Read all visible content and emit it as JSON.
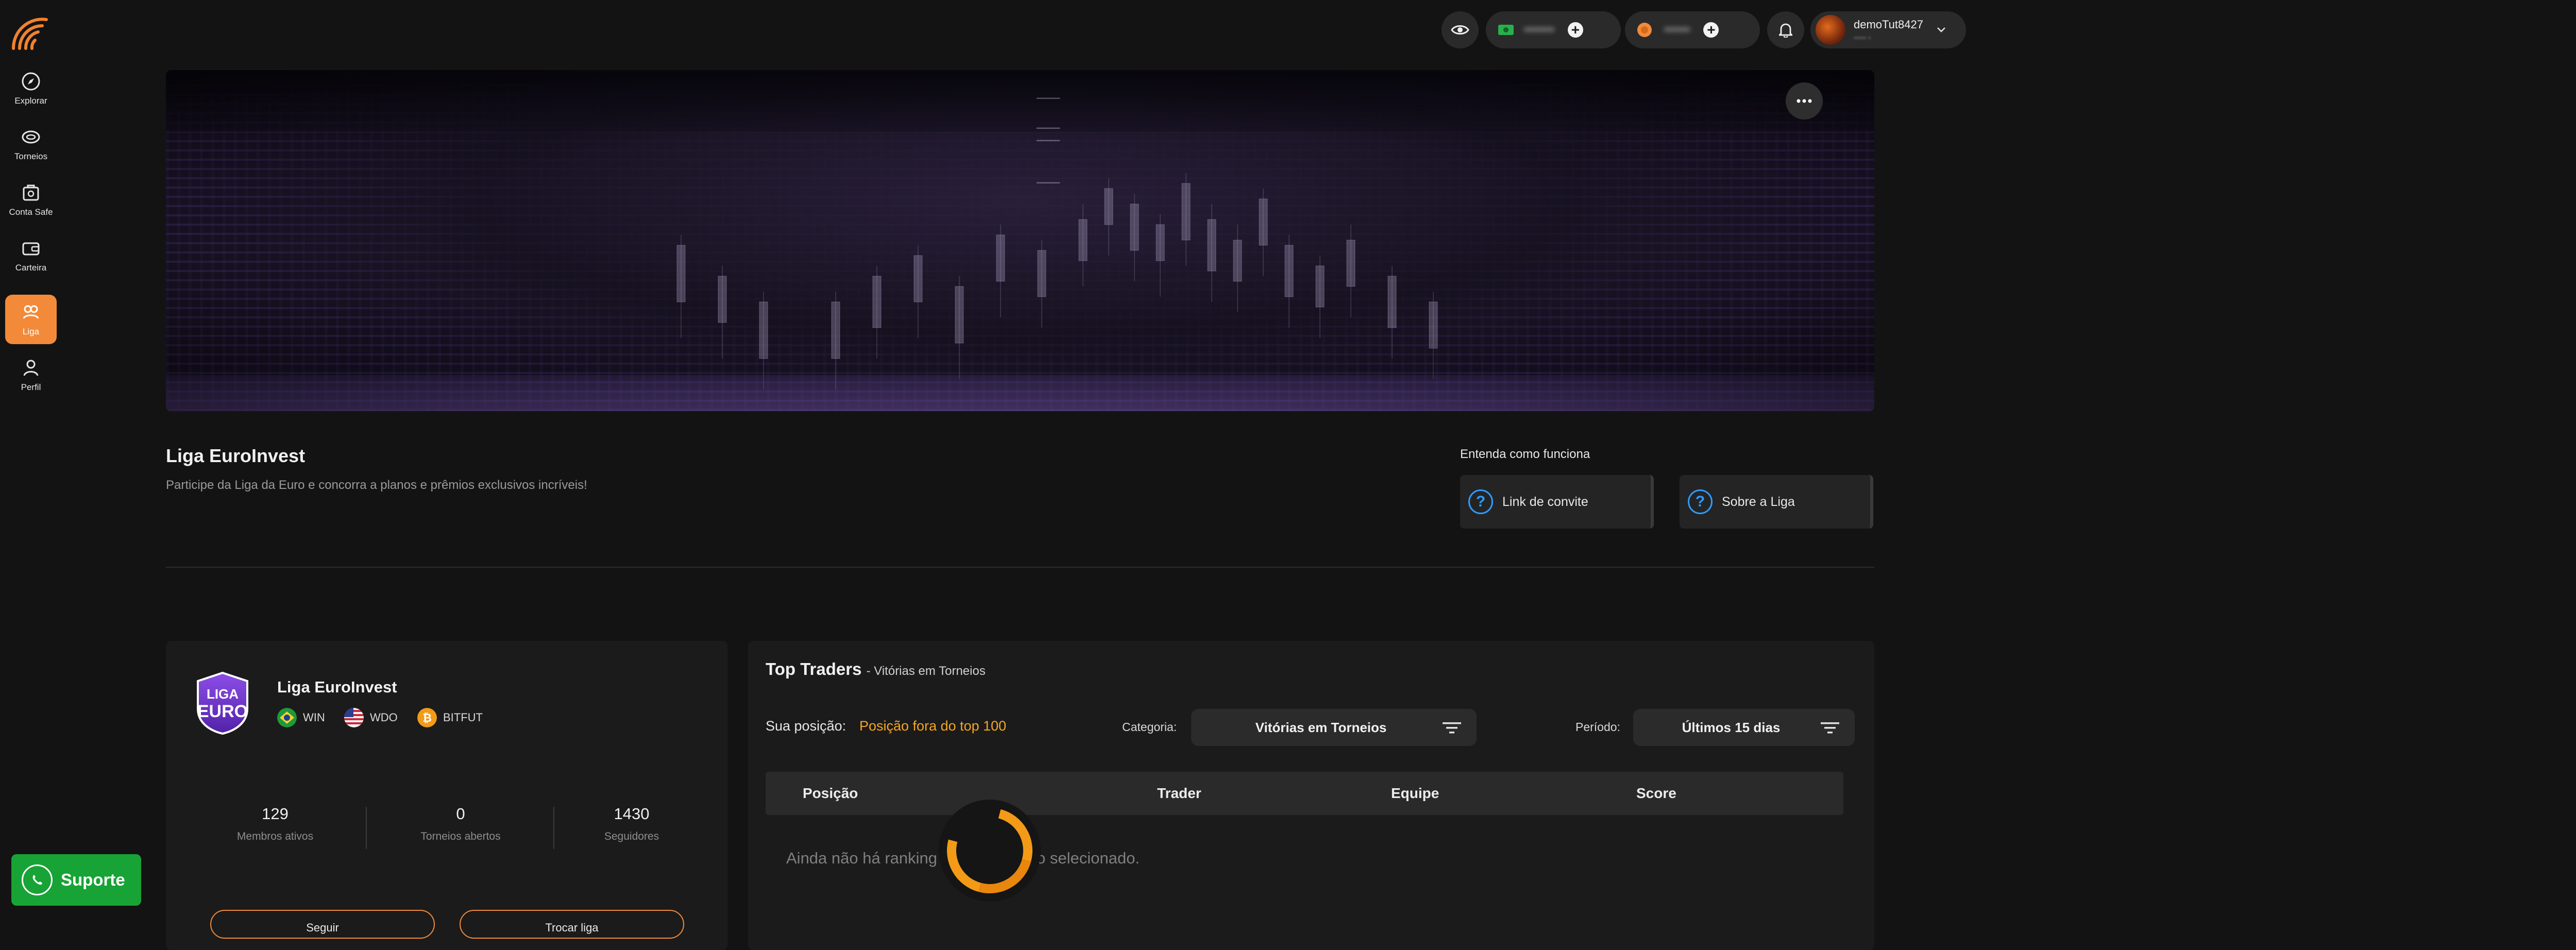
{
  "nav": {
    "items": [
      {
        "label": "Explorar"
      },
      {
        "label": "Torneios"
      },
      {
        "label": "Conta Safe"
      },
      {
        "label": "Carteira"
      },
      {
        "label": "Liga"
      },
      {
        "label": "Perfil"
      }
    ],
    "active": "Liga"
  },
  "topbar": {
    "username": "demoTut8427"
  },
  "league": {
    "title": "Liga EuroInvest",
    "subtitle": "Participe da Liga da Euro e concorra a planos e prêmios exclusivos incríveis!",
    "how_title": "Entenda como funciona",
    "invite_link": "Link de convite",
    "about": "Sobre a Liga"
  },
  "card": {
    "logo_top": "LIGA",
    "logo_bottom": "EURO",
    "name": "Liga EuroInvest",
    "assets": [
      "WIN",
      "WDO",
      "BITFUT"
    ],
    "stats": [
      {
        "value": "129",
        "label": "Membros ativos"
      },
      {
        "value": "0",
        "label": "Torneios abertos"
      },
      {
        "value": "1430",
        "label": "Seguidores"
      }
    ],
    "buttons": [
      "Seguir",
      "Trocar liga"
    ]
  },
  "ranking": {
    "title": "Top Traders",
    "subtitle": "- Vitórias em Torneios",
    "position_label": "Sua posição:",
    "position_value": "Posição fora do top 100",
    "category_label": "Categoria:",
    "category_value": "Vitórias em Torneios",
    "period_label": "Período:",
    "period_value": "Últimos 15 dias",
    "columns": [
      "Posição",
      "Trader",
      "Equipe",
      "Score"
    ],
    "empty_message": "Ainda não há ranking para o período selecionado."
  },
  "support": {
    "label": "Suporte"
  },
  "colors": {
    "accent": "#f28a3a",
    "support": "#17a335",
    "highlight": "#f5a623"
  }
}
